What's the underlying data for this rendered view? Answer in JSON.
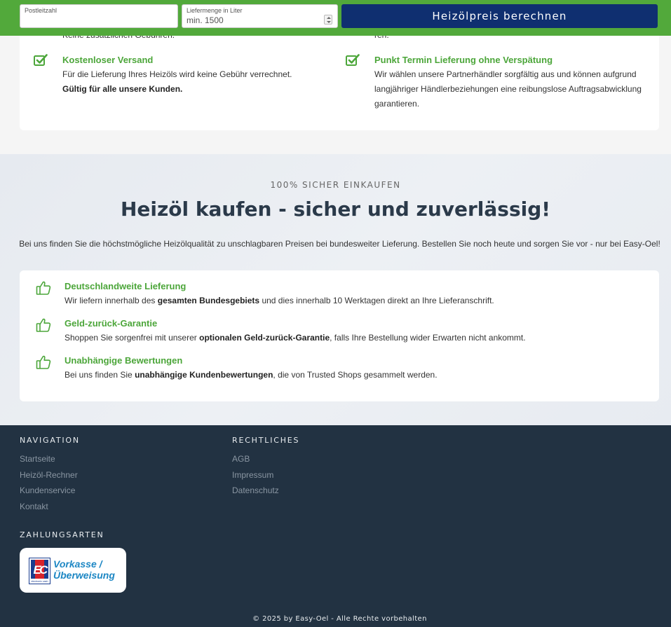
{
  "form": {
    "postcode_label": "Postleitzahl",
    "postcode_value": "",
    "quantity_label": "Liefermenge in Liter",
    "quantity_placeholder": "min. 1500",
    "submit_label": "Heizölpreis berechnen"
  },
  "top_features": {
    "cut_left": "Keine zusätzlichen Gebühren.",
    "cut_right": "ren.",
    "items": [
      {
        "icon": "check-icon",
        "title": "Kostenloser Versand",
        "desc": "Für die Lieferung Ihres Heizöls wird keine Gebühr verrechnet.",
        "desc_bold": "Gültig für alle unsere Kunden."
      },
      {
        "icon": "check-icon",
        "title": "Punkt Termin Lieferung ohne Verspätung",
        "desc": "Wir wählen unsere Partnerhändler sorgfältig aus und können aufgrund langjähriger Händlerbeziehungen eine reibungslose Auftragsabwicklung garantieren."
      }
    ]
  },
  "secure": {
    "eyebrow": "100% SICHER EINKAUFEN",
    "headline": "Heizöl kaufen - sicher und zuverlässig!",
    "lead": "Bei uns finden Sie die höchstmögliche Heizölqualität zu unschlagbaren Preisen bei bundesweiter Lieferung. Bestellen Sie noch heute und sorgen Sie vor - nur bei Easy-Oel!",
    "benefits": [
      {
        "icon": "thumbs-up-icon",
        "title": "Deutschlandweite Lieferung",
        "pre": "Wir liefern innerhalb des ",
        "bold": "gesamten Bundesgebiets",
        "post": " und dies innerhalb 10 Werktagen direkt an Ihre Lieferanschrift."
      },
      {
        "icon": "thumbs-up-icon",
        "title": "Geld-zurück-Garantie",
        "pre": "Shoppen Sie sorgenfrei mit unserer ",
        "bold": "optionalen Geld-zurück-Garantie",
        "post": ", falls Ihre Bestellung wider Erwarten nicht ankommt."
      },
      {
        "icon": "thumbs-up-icon",
        "title": "Unabhängige Bewertungen",
        "pre": "Bei uns finden Sie ",
        "bold": "unabhängige Kundenbewertungen",
        "post": ", die von Trusted Shops gesammelt werden."
      }
    ]
  },
  "footer": {
    "nav_heading": "NAVIGATION",
    "nav_links": [
      "Startseite",
      "Heizöl-Rechner",
      "Kundenservice",
      "Kontakt"
    ],
    "legal_heading": "RECHTLICHES",
    "legal_links": [
      "AGB",
      "Impressum",
      "Datenschutz"
    ],
    "payment_heading": "ZAHLUNGSARTEN",
    "payment": {
      "icon": "ec-electronic-cash-icon",
      "logo_text": "electronic cash",
      "line1": "Vorkasse /",
      "line2": "Überweisung"
    },
    "copyright": "© 2025 by Easy-Oel - Alle Rechte vorbehalten"
  },
  "colors": {
    "green": "#52a93b",
    "green_text": "#4ca63a",
    "navy_button": "#0f2f70",
    "footer_bg": "#223242",
    "payment_blue": "#1d87c4"
  }
}
